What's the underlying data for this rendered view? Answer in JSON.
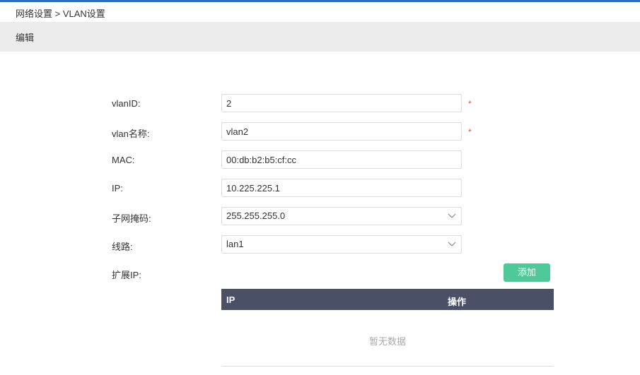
{
  "breadcrumb": "网络设置 > VLAN设置",
  "section_title": "编辑",
  "form": {
    "vlan_id": {
      "label": "vlanID:",
      "value": "2",
      "required_mark": "*"
    },
    "vlan_name": {
      "label": "vlan名称:",
      "value": "vlan2",
      "required_mark": "*"
    },
    "mac": {
      "label": "MAC:",
      "value": "00:db:b2:b5:cf:cc"
    },
    "ip": {
      "label": "IP:",
      "value": "10.225.225.1"
    },
    "subnet_mask": {
      "label": "子网掩码:",
      "value": "255.255.255.0"
    },
    "line": {
      "label": "线路:",
      "value": "lan1"
    },
    "ext_ip": {
      "label": "扩展IP:"
    }
  },
  "add_button": "添加",
  "table": {
    "headers": {
      "ip": "IP",
      "operation": "操作"
    },
    "empty_text": "暂无数据"
  },
  "colors": {
    "accent_bar": "#2a6fb8",
    "add_button": "#4fc89a",
    "table_header": "#4a5166",
    "required": "#e5533c"
  },
  "icons": {
    "select_arrow": "chevron-down-icon"
  }
}
